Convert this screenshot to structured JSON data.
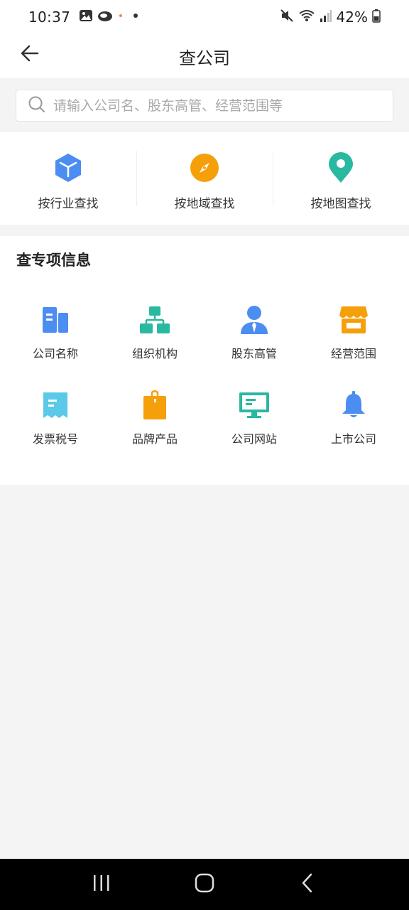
{
  "status_bar": {
    "time": "10:37",
    "battery": "42%",
    "left_icons": [
      "image-icon",
      "cloud-icon",
      "dot-icon",
      "dot-icon"
    ],
    "right_icons": [
      "mute-icon",
      "wifi-icon",
      "signal-icon",
      "battery-icon"
    ]
  },
  "header": {
    "back_icon": "arrow-left-icon",
    "title": "查公司"
  },
  "search": {
    "icon": "search-icon",
    "placeholder": "请输入公司名、股东高管、经营范围等",
    "value": ""
  },
  "quick_search": {
    "items": [
      {
        "label": "按行业查找",
        "icon": "cube-icon",
        "color": "#4b8df0"
      },
      {
        "label": "按地域查找",
        "icon": "compass-icon",
        "color": "#f5a00b"
      },
      {
        "label": "按地图查找",
        "icon": "map-pin-icon",
        "color": "#29b8a0"
      }
    ]
  },
  "special": {
    "title": "查专项信息",
    "items": [
      {
        "label": "公司名称",
        "icon": "building-icon",
        "color": "#4b8df0"
      },
      {
        "label": "组织机构",
        "icon": "org-chart-icon",
        "color": "#29b8a0"
      },
      {
        "label": "股东高管",
        "icon": "person-tie-icon",
        "color": "#4b8df0"
      },
      {
        "label": "经营范围",
        "icon": "store-icon",
        "color": "#f5a00b"
      },
      {
        "label": "发票税号",
        "icon": "receipt-icon",
        "color": "#5bc9e8"
      },
      {
        "label": "品牌产品",
        "icon": "shopping-bag-icon",
        "color": "#f5a00b"
      },
      {
        "label": "公司网站",
        "icon": "monitor-icon",
        "color": "#29b8a0"
      },
      {
        "label": "上市公司",
        "icon": "bell-icon",
        "color": "#4b8df0"
      }
    ]
  },
  "nav_bar": {
    "items": [
      "recent-apps-icon",
      "home-icon",
      "back-icon"
    ]
  }
}
